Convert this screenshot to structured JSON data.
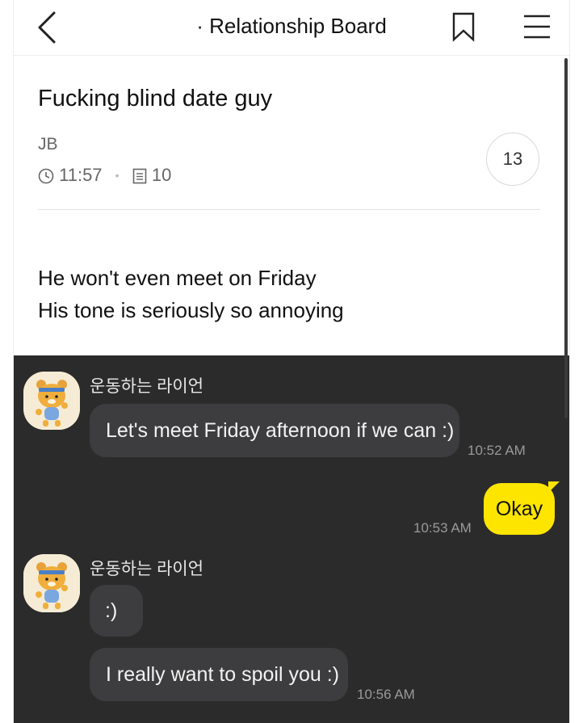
{
  "header": {
    "board_title": "· Relationship Board"
  },
  "post": {
    "title": "Fucking blind date guy",
    "author": "JB",
    "time": "11:57",
    "views": "10",
    "comment_count": "13",
    "body_lines": [
      "He won't even meet on Friday",
      "His tone is seriously so annoying"
    ]
  },
  "chat": {
    "messages": [
      {
        "sender": "운동하는 라이언",
        "text": "Let's meet Friday afternoon if we can :)",
        "time": "10:52 AM"
      },
      {
        "sender": "me",
        "text": "Okay",
        "time": "10:53 AM"
      },
      {
        "sender": "운동하는 라이언",
        "text": ":)",
        "time": ""
      },
      {
        "sender": "운동하는 라이언",
        "text": "I really want to spoil you :)",
        "time": "10:56 AM"
      }
    ]
  },
  "colors": {
    "chat_background": "#2b2b2b",
    "incoming_bubble": "#3d3d3f",
    "outgoing_bubble": "#fee500"
  },
  "icons": [
    "back-chevron-icon",
    "bookmark-icon",
    "menu-icon",
    "clock-icon",
    "document-icon",
    "ryan-avatar-icon"
  ]
}
